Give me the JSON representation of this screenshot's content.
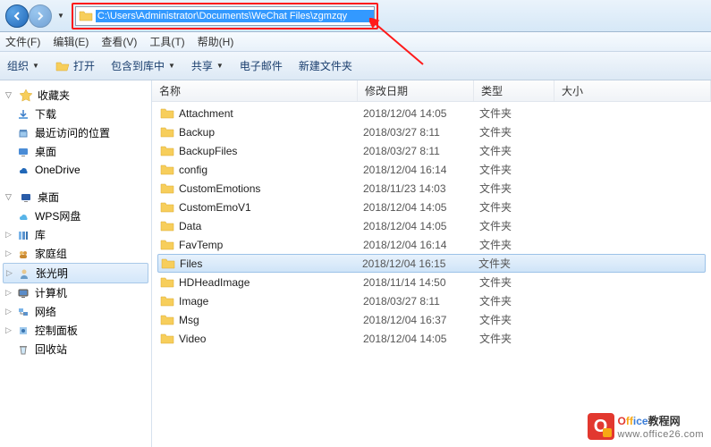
{
  "address_bar": {
    "path": "C:\\Users\\Administrator\\Documents\\WeChat Files\\zgmzqy"
  },
  "menubar": {
    "file": "文件(F)",
    "edit": "编辑(E)",
    "view": "查看(V)",
    "tools": "工具(T)",
    "help": "帮助(H)"
  },
  "toolbar": {
    "organize": "组织",
    "open": "打开",
    "include": "包含到库中",
    "share": "共享",
    "email": "电子邮件",
    "new_folder": "新建文件夹"
  },
  "sidebar": {
    "favorites": {
      "label": "收藏夹",
      "items": [
        {
          "label": "下载"
        },
        {
          "label": "最近访问的位置"
        },
        {
          "label": "桌面"
        },
        {
          "label": "OneDrive"
        }
      ]
    },
    "desktop": {
      "label": "桌面",
      "items": [
        {
          "label": "WPS网盘"
        },
        {
          "label": "库"
        },
        {
          "label": "家庭组"
        },
        {
          "label": "张光明",
          "selected": true
        },
        {
          "label": "计算机"
        },
        {
          "label": "网络"
        },
        {
          "label": "控制面板"
        },
        {
          "label": "回收站"
        }
      ]
    }
  },
  "columns": {
    "name": "名称",
    "date": "修改日期",
    "type": "类型",
    "size": "大小"
  },
  "files": [
    {
      "name": "Attachment",
      "date": "2018/12/04 14:05",
      "type": "文件夹"
    },
    {
      "name": "Backup",
      "date": "2018/03/27 8:11",
      "type": "文件夹"
    },
    {
      "name": "BackupFiles",
      "date": "2018/03/27 8:11",
      "type": "文件夹"
    },
    {
      "name": "config",
      "date": "2018/12/04 16:14",
      "type": "文件夹"
    },
    {
      "name": "CustomEmotions",
      "date": "2018/11/23 14:03",
      "type": "文件夹"
    },
    {
      "name": "CustomEmoV1",
      "date": "2018/12/04 14:05",
      "type": "文件夹"
    },
    {
      "name": "Data",
      "date": "2018/12/04 14:05",
      "type": "文件夹"
    },
    {
      "name": "FavTemp",
      "date": "2018/12/04 16:14",
      "type": "文件夹"
    },
    {
      "name": "Files",
      "date": "2018/12/04 16:15",
      "type": "文件夹",
      "selected": true
    },
    {
      "name": "HDHeadImage",
      "date": "2018/11/14 14:50",
      "type": "文件夹"
    },
    {
      "name": "Image",
      "date": "2018/03/27 8:11",
      "type": "文件夹"
    },
    {
      "name": "Msg",
      "date": "2018/12/04 16:37",
      "type": "文件夹"
    },
    {
      "name": "Video",
      "date": "2018/12/04 14:05",
      "type": "文件夹"
    }
  ],
  "watermark": {
    "title": "Office教程网",
    "url": "www.office26.com"
  }
}
